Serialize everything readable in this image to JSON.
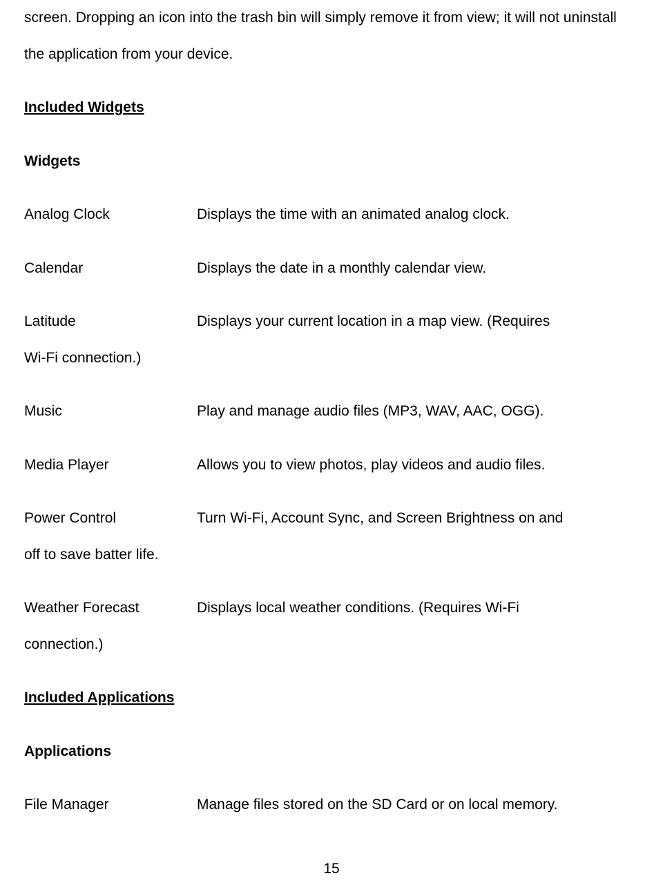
{
  "intro": "screen. Dropping an icon into the trash bin will simply remove it from view; it will not uninstall the application from your device.",
  "section1": {
    "heading": "Included Widgets",
    "subheading": "Widgets"
  },
  "widgets": {
    "analog_clock": {
      "label": "Analog Clock",
      "desc": "Displays the time with an animated analog clock."
    },
    "calendar": {
      "label": "Calendar",
      "desc": "Displays the date in a monthly calendar view."
    },
    "latitude": {
      "label": "Latitude",
      "desc": "Displays your current location in a map view. (Requires",
      "cont": "Wi-Fi connection.)"
    },
    "music": {
      "label": "Music",
      "desc": "Play and manage audio files (MP3, WAV, AAC, OGG)."
    },
    "media_player": {
      "label": "Media Player",
      "desc": "Allows you to view photos, play videos and audio files."
    },
    "power_control": {
      "label": "Power Control",
      "desc": "Turn Wi-Fi, Account Sync, and Screen Brightness on and",
      "cont": "off to save batter life."
    },
    "weather": {
      "label": "Weather Forecast",
      "desc": "Displays local weather conditions. (Requires Wi-Fi",
      "cont": "connection.)"
    }
  },
  "section2": {
    "heading": "Included Applications",
    "subheading": "Applications"
  },
  "apps": {
    "file_manager": {
      "label": "File Manager",
      "desc": "Manage files stored on the SD Card or on local memory."
    }
  },
  "page_number": "15"
}
